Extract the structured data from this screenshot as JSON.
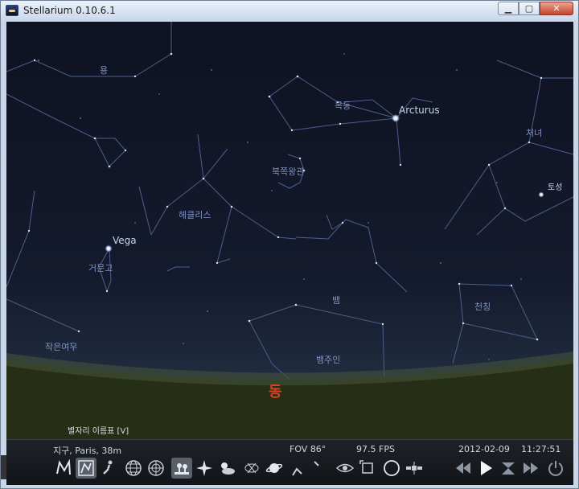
{
  "window": {
    "title": "Stellarium 0.10.6.1"
  },
  "colors": {
    "sky": "#0e1222",
    "constellation_line": "#4c5f8c",
    "label": "#7f92c4",
    "cardinal": "#e0401c"
  },
  "constellations": [
    {
      "id": "draco",
      "label": "용"
    },
    {
      "id": "bootes",
      "label": "목동"
    },
    {
      "id": "virgo",
      "label": "처녀"
    },
    {
      "id": "corona",
      "label": "북쪽왕관"
    },
    {
      "id": "hercules",
      "label": "헤클리스"
    },
    {
      "id": "lyra",
      "label": "거문고"
    },
    {
      "id": "serpens",
      "label": "뱀"
    },
    {
      "id": "libra",
      "label": "천칭"
    },
    {
      "id": "ophiuchus",
      "label": "뱀주인"
    },
    {
      "id": "vulpecula",
      "label": "작은여우"
    }
  ],
  "stars": [
    {
      "name": "Arcturus"
    },
    {
      "name": "Vega"
    },
    {
      "name": "토성"
    }
  ],
  "cardinal": {
    "east": "동"
  },
  "status_message": "별자리 이름표 [V]",
  "info": {
    "location": "지구, Paris, 38m",
    "fov": "FOV 86°",
    "fps": "97.5 FPS",
    "date": "2012-02-09",
    "time": "11:27:51"
  },
  "toolbar": {
    "left": [
      {
        "id": "constellation-lines",
        "icon": "lines-icon",
        "active": false
      },
      {
        "id": "constellation-labels",
        "icon": "labels-icon",
        "active": true
      },
      {
        "id": "constellation-art",
        "icon": "art-icon",
        "active": false
      },
      {
        "id": "equatorial-grid",
        "icon": "grid-icon",
        "active": false
      },
      {
        "id": "azimuth-grid",
        "icon": "azgrid-icon",
        "active": false
      },
      {
        "id": "ground",
        "icon": "ground-icon",
        "active": true
      },
      {
        "id": "cardinal-points",
        "icon": "cardinal-icon",
        "active": false
      },
      {
        "id": "atmosphere",
        "icon": "atmosphere-icon",
        "active": false
      },
      {
        "id": "nebulas",
        "icon": "nebula-icon",
        "active": false
      },
      {
        "id": "planet-labels",
        "icon": "planet-icon",
        "active": false
      },
      {
        "id": "equatorial-mount",
        "icon": "mount-icon",
        "active": false
      },
      {
        "id": "center-selected",
        "icon": "crosshair-icon",
        "active": false
      },
      {
        "id": "night-mode",
        "icon": "eye-icon",
        "active": false
      },
      {
        "id": "fullscreen",
        "icon": "fullscreen-icon",
        "active": false
      },
      {
        "id": "ocular",
        "icon": "circle-icon",
        "active": false
      },
      {
        "id": "satellites",
        "icon": "satellite-icon",
        "active": false
      }
    ],
    "right": [
      {
        "id": "rewind",
        "icon": "rewind-icon"
      },
      {
        "id": "play",
        "icon": "play-icon"
      },
      {
        "id": "real-time",
        "icon": "hourglass-icon"
      },
      {
        "id": "fast-forward",
        "icon": "fastforward-icon"
      },
      {
        "id": "quit",
        "icon": "power-icon"
      }
    ]
  }
}
